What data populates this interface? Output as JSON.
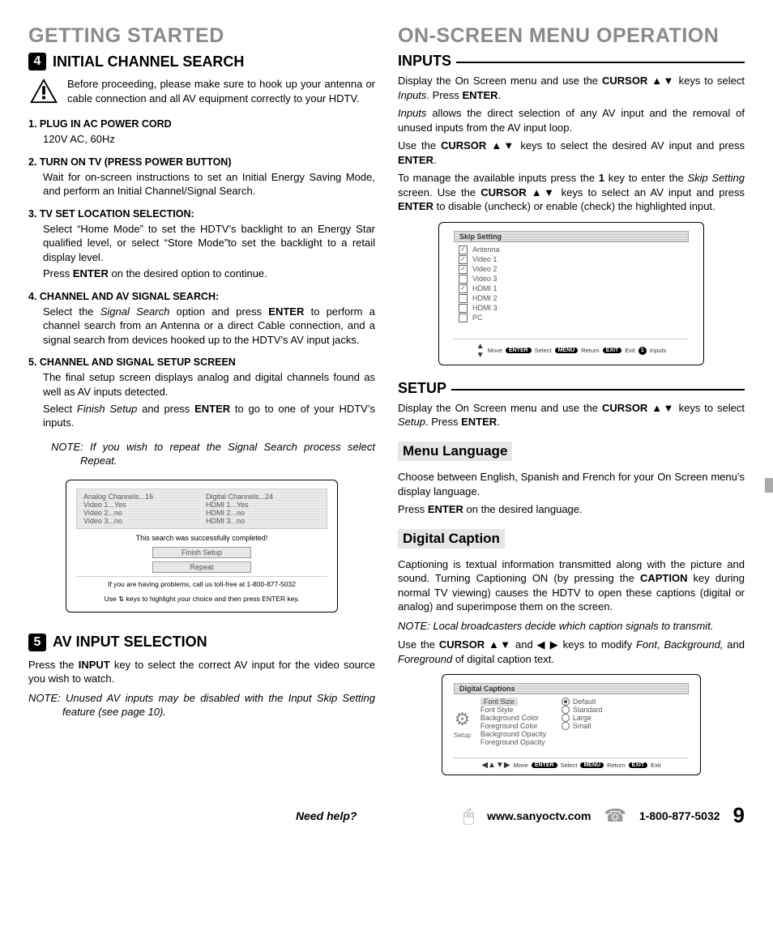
{
  "left": {
    "heading": "GETTING STARTED",
    "step4": {
      "num": "4",
      "title": "INITIAL CHANNEL SEARCH",
      "warning": "Before proceeding, please make sure to hook up your antenna or cable connection and all AV equipment correctly to your HDTV.",
      "items": [
        {
          "title": "1. PLUG IN AC POWER CORD",
          "body": [
            "120V AC, 60Hz"
          ]
        },
        {
          "title": "2. TURN ON TV (PRESS POWER BUTTON)",
          "body": [
            "Wait for on-screen instructions to set an Initial Energy Saving Mode, and perform an Initial Channel/Signal Search."
          ]
        },
        {
          "title": "3. TV SET LOCATION SELECTION:",
          "body": [
            "Select “Home Mode” to set the HDTV’s backlight to an Energy Star qualified level, or select “Store Mode”to set the backlight to a retail display level.",
            "Press <b>ENTER</b> on the desired option to continue."
          ]
        },
        {
          "title": "4. CHANNEL AND AV SIGNAL SEARCH:",
          "body": [
            "Select the <i>Signal Search</i> option and press <b>ENTER</b> to perform a channel search from an Antenna or a direct Cable connection, and a signal search from devices hooked up to the HDTV’s AV input jacks."
          ]
        },
        {
          "title": "5. CHANNEL AND SIGNAL SETUP SCREEN",
          "body": [
            "The final setup screen displays analog and digital channels found as well as AV inputs detected.",
            "Select <i>Finish Setup</i> and press <b>ENTER</b> to go to one of your HDTV’s inputs."
          ]
        }
      ],
      "note": "If you wish to repeat the Signal Search process select Repeat.",
      "panel": {
        "leftcol": [
          "Analog Channels...16",
          "Video 1...Yes",
          "Video 2...no",
          "Video 3...no"
        ],
        "rightcol": [
          "Digital Channels...24",
          "HDMI 1...Yes",
          "HDMI 2...no",
          "HDMI 3...no"
        ],
        "msg": "This search was successfully completed!",
        "btn1": "Finish Setup",
        "btn2": "Repeat",
        "foot1": "If you are having problems, call us toll-free at 1-800-877-5032",
        "foot2": "Use ⇅ keys to highlight your choice and then press ENTER key."
      }
    },
    "step5": {
      "num": "5",
      "title": "AV INPUT SELECTION",
      "p1": "Press the <b>INPUT</b> key to select the correct AV input for the video source you wish to watch.",
      "note": "Unused AV inputs may be disabled with the Input Skip Setting feature (see page 10)."
    }
  },
  "right": {
    "heading": "ON-SCREEN MENU OPERATION",
    "inputs": {
      "title": "INPUTS",
      "p1": "Display the On Screen menu and use the <b>CURSOR</b> ▲▼ keys to select <i>Inputs</i>. Press <b>ENTER</b>.",
      "p2": "<i>Inputs</i> allows the direct selection of any AV input  and the removal of unused inputs from the AV input loop.",
      "p3": "Use the <b>CURSOR</b> ▲▼ keys to select the desired AV input and press <b>ENTER</b>.",
      "p4": "To manage the available inputs press the <b>1</b> key to enter the <i>Skip Setting</i> screen. Use the <b>CURSOR</b> ▲▼ keys to select an AV input and press <b>ENTER</b> to disable (uncheck) or enable (check) the highlighted  input.",
      "panel": {
        "title": "Skip Setting",
        "items": [
          {
            "checked": true,
            "label": "Antenna"
          },
          {
            "checked": true,
            "label": "Video 1"
          },
          {
            "checked": true,
            "label": "Video 2"
          },
          {
            "checked": false,
            "label": "Video 3"
          },
          {
            "checked": true,
            "label": "HDMI 1"
          },
          {
            "checked": false,
            "label": "HDMI 2"
          },
          {
            "checked": false,
            "label": "HDMI 3"
          },
          {
            "checked": false,
            "label": "PC"
          }
        ],
        "nav": [
          "Move",
          "Select",
          "Return",
          "Exit",
          "Inputs"
        ]
      }
    },
    "setup": {
      "title": "SETUP",
      "p1": "Display the On Screen menu and use the <b>CURSOR</b> ▲▼ keys to select <i>Setup</i>. Press <b>ENTER</b>."
    },
    "menulang": {
      "title": "Menu Language",
      "p1": "Choose between English, Spanish and French for your On Screen menu’s display language.",
      "p2": "Press <b>ENTER</b> on the desired language."
    },
    "caption": {
      "title": "Digital Caption",
      "p1": "Captioning is textual information transmitted along with the picture and sound. Turning Captioning ON (by pressing the <b>CAPTION</b> key during normal TV viewing) causes the HDTV to open these captions (digital or analog) and superimpose them on the screen.",
      "note": "Local broadcasters decide which caption signals to transmit.",
      "p2": "Use the <b>CURSOR</b> ▲▼ and ◀ ▶ keys to modify <i>Font</i>, <i>Background,</i> and <i>Foreground</i> of digital caption text.",
      "panel": {
        "title": "Digital Captions",
        "setup_label": "Setup",
        "rows": [
          {
            "label": "Font Size",
            "opt": "Default",
            "sel": true,
            "hl": true
          },
          {
            "label": "Font Style",
            "opt": "Standard"
          },
          {
            "label": "Background Color",
            "opt": "Large"
          },
          {
            "label": "Foreground Color",
            "opt": "Small"
          },
          {
            "label": "Background Opacity",
            "opt": ""
          },
          {
            "label": "Foreground Opacity",
            "opt": ""
          }
        ],
        "nav": [
          "Move",
          "Select",
          "Return",
          "Exit"
        ]
      }
    }
  },
  "footer": {
    "need": "Need help?",
    "url": "www.sanyoctv.com",
    "phone": "1-800-877-5032",
    "page": "9"
  }
}
